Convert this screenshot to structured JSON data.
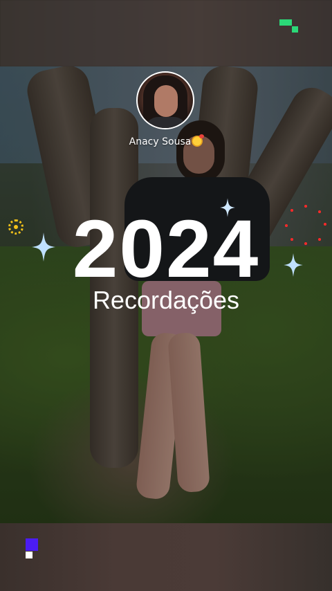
{
  "profile": {
    "username": "Anacy Sousa",
    "emoji_icon": "smiling-face-with-hearts-emoji"
  },
  "title": {
    "year": "2024",
    "subtitle": "Recordações"
  },
  "icons": {
    "top_right": "kwai-logo-icon",
    "bottom_left": "brand-block-icon",
    "decorations": [
      "sparkle-icon",
      "sun-icon",
      "red-dots-icon"
    ]
  },
  "colors": {
    "text": "#ffffff",
    "sparkle": "#bfe0ff",
    "sun": "#f3c21a",
    "logo_green": "#2bd978",
    "logo_blue": "#4b1cf2",
    "dots": "#ff2a2a"
  }
}
